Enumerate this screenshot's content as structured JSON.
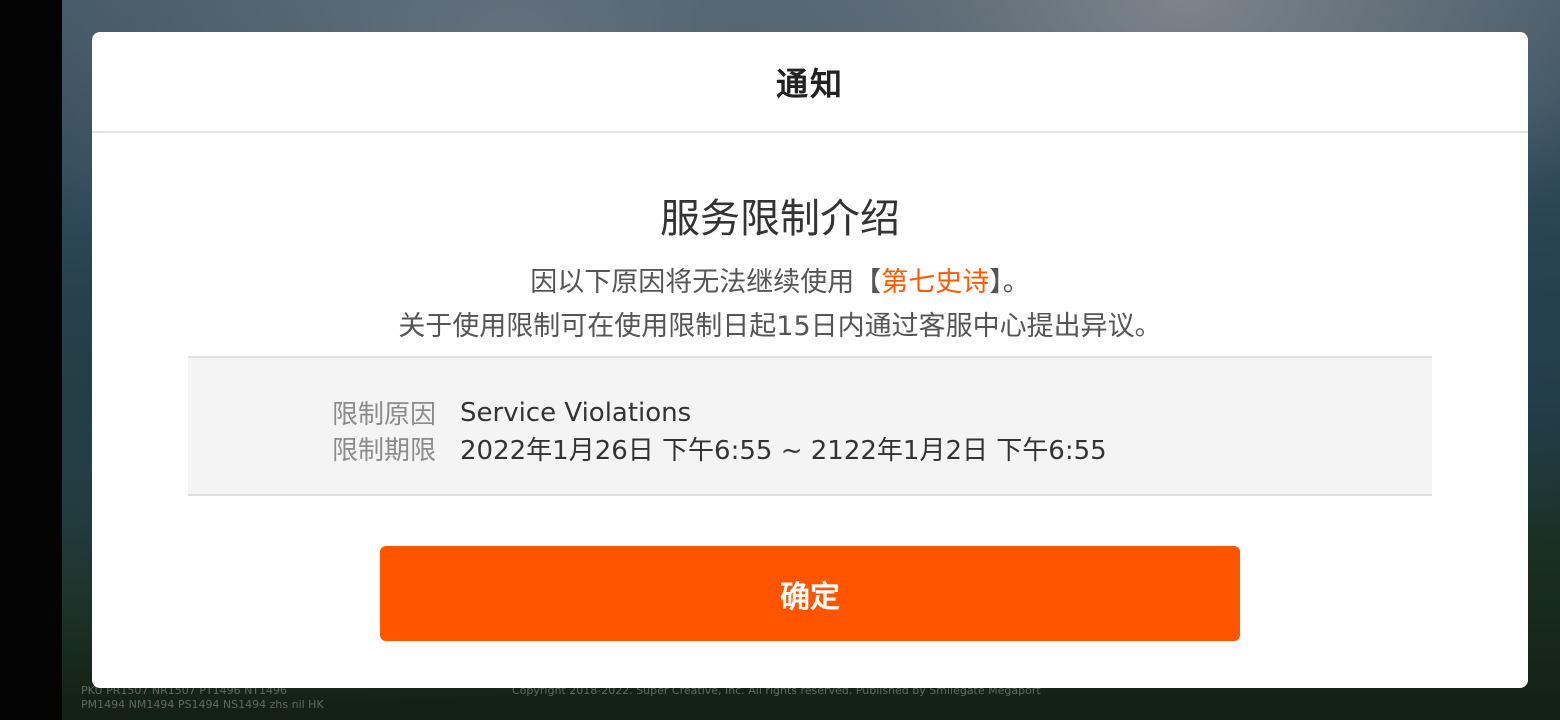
{
  "background": {
    "version_line1": "PKU PR1507 NR1507 PT1496 NT1496",
    "version_line2": "PM1494 NM1494 PS1494 NS1494 zhs nil HK",
    "copyright": "Copyright 2018-2022. Super Creative, Inc. All rights reserved. Published by Smilegate Megaport"
  },
  "dialog": {
    "title": "通知",
    "heading": "服务限制介绍",
    "desc_line1_prefix": "因以下原因将无法继续使用【",
    "game_name": "第七史诗",
    "desc_line1_suffix": "】。",
    "desc_line2": "关于使用限制可在使用限制日起15日内通过客服中心提出异议。",
    "reason_label": "限制原因",
    "reason_value": "Service Violations",
    "period_label": "限制期限",
    "period_value": "2022年1月26日 下午6:55 ~ 2122年1月2日 下午6:55",
    "confirm_label": "确定"
  },
  "colors": {
    "accent": "#ff5500",
    "highlight": "#ff5a00"
  }
}
